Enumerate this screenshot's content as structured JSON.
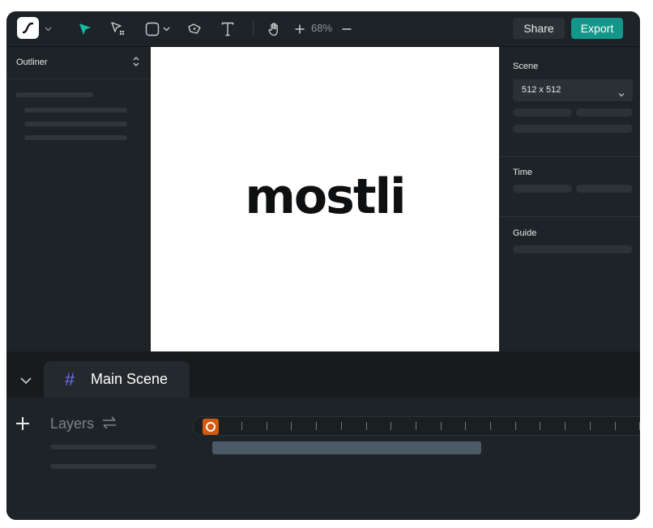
{
  "toolbar": {
    "logo_icon": "rive-logo-icon",
    "icons": [
      "logo-chevron-down-icon",
      "select-tool-icon",
      "pen-tool-icon",
      "shape-tool-icon",
      "shape-chevron-down-icon",
      "bone-tool-icon",
      "text-tool-icon",
      "hand-tool-icon",
      "zoom-in-icon",
      "zoom-out-icon"
    ],
    "zoom_label": "68%",
    "share_label": "Share",
    "export_label": "Export",
    "accent_color": "#13978a"
  },
  "outliner": {
    "title": "Outliner",
    "sort_icon": "sort-icon"
  },
  "canvas": {
    "text": "mostli",
    "background": "#ffffff"
  },
  "properties": {
    "scene": {
      "title": "Scene",
      "size_value": "512 x 512"
    },
    "time": {
      "title": "Time"
    },
    "guide": {
      "title": "Guide"
    }
  },
  "bottom": {
    "collapse_icon": "chevron-down-icon",
    "scene_tab": {
      "hash": "#",
      "name": "Main Scene",
      "hash_color": "#6c6cf5"
    },
    "layers_label": "Layers",
    "add_icon": "plus-icon",
    "swap_icon": "swap-icon",
    "playhead_color": "#d35a0e",
    "tick_count": 17
  }
}
